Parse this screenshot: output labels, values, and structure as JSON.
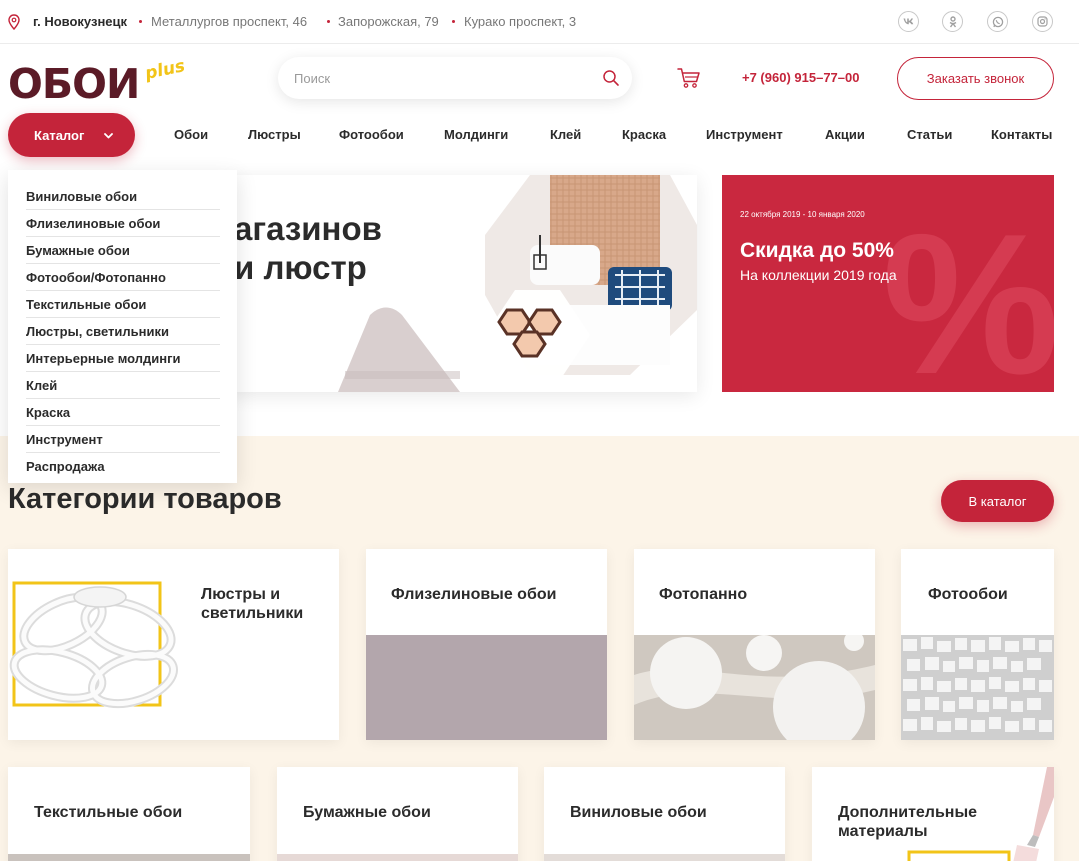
{
  "topbar": {
    "city": "г. Новокузнецк",
    "addresses": [
      "Металлургов проспект, 46",
      "Запорожская, 79",
      "Курако проспект, 3"
    ],
    "social": [
      "vk",
      "ok",
      "wa",
      "ig"
    ]
  },
  "header": {
    "logo_main": "ОБОИ",
    "logo_plus": "plus",
    "search_placeholder": "Поиск",
    "phone": "+7 (960) 915–77–00",
    "callback_label": "Заказать звонок"
  },
  "nav": {
    "catalog_label": "Каталог",
    "items": [
      "Обои",
      "Люстры",
      "Фотообои",
      "Молдинги",
      "Клей",
      "Краска",
      "Инструмент",
      "Акции",
      "Статьи",
      "Контакты"
    ]
  },
  "dropdown": {
    "items": [
      "Виниловые обои",
      "Флизелиновые обои",
      "Бумажные обои",
      "Фотообои/Фотопанно",
      "Текстильные обои",
      "Люстры, светильники",
      "Интерьерные молдинги",
      "Клей",
      "Краска",
      "Инструмент",
      "Распродажа"
    ]
  },
  "hero": {
    "line1": "агазинов",
    "line2": "и люстр"
  },
  "promo": {
    "dates": "22 октября 2019 - 10 января 2020",
    "title": "Скидка до 50%",
    "subtitle": "На коллекции 2019 года",
    "bg_symbol": "%",
    "color": "#c9283f"
  },
  "categories": {
    "title": "Категории товаров",
    "button_label": "В каталог",
    "row1": [
      "Люстры и светильники",
      "Флизелиновые обои",
      "Фотопанно",
      "Фотообои"
    ],
    "row2": [
      "Текстильные обои",
      "Бумажные обои",
      "Виниловые обои",
      "Дополнительные материалы"
    ]
  },
  "colors": {
    "accent": "#c4243a",
    "logo": "#5b1b27",
    "logo_plus": "#f2c418",
    "section_bg": "#fcf4e8"
  }
}
